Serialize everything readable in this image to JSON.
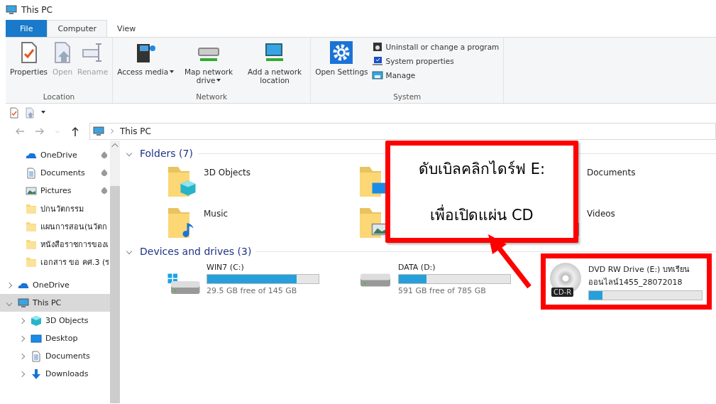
{
  "window": {
    "title": "This PC"
  },
  "tabs": [
    {
      "label": "File",
      "kind": "file",
      "selected": false
    },
    {
      "label": "Computer",
      "kind": "tab",
      "selected": true
    },
    {
      "label": "View",
      "kind": "tab",
      "selected": false
    }
  ],
  "ribbon": {
    "groups": [
      {
        "name": "Location",
        "commands": [
          {
            "label": "Properties",
            "disabled": false,
            "dropdown": false
          },
          {
            "label": "Open",
            "disabled": true,
            "dropdown": false
          },
          {
            "label": "Rename",
            "disabled": true,
            "dropdown": false
          }
        ]
      },
      {
        "name": "Network",
        "commands": [
          {
            "label": "Access media",
            "disabled": false,
            "dropdown": true
          },
          {
            "label": "Map network drive",
            "disabled": false,
            "dropdown": true
          },
          {
            "label": "Add a network location",
            "disabled": false,
            "dropdown": false
          }
        ]
      },
      {
        "name": "System",
        "commands": [
          {
            "label": "Open Settings",
            "disabled": false,
            "dropdown": false
          }
        ],
        "small_commands": [
          {
            "label": "Uninstall or change a program"
          },
          {
            "label": "System properties"
          },
          {
            "label": "Manage"
          }
        ]
      }
    ]
  },
  "address": {
    "path": "This PC"
  },
  "nav": {
    "pinned_items": [
      {
        "name": "OneDrive",
        "pinned": true
      },
      {
        "name": "Documents",
        "pinned": true
      },
      {
        "name": "Pictures",
        "pinned": true
      },
      {
        "name": "ปกนวัตกรรม"
      },
      {
        "name": "แผนการสอน(นวัตก"
      },
      {
        "name": "หนังสือราชการของเ"
      },
      {
        "name": "เอกสาร ขอ คศ.3 (ร"
      }
    ],
    "tree": [
      {
        "name": "OneDrive",
        "expanded": false,
        "selected": false
      },
      {
        "name": "This PC",
        "expanded": true,
        "selected": true,
        "children": [
          {
            "name": "3D Objects",
            "expanded": false,
            "selected": false
          },
          {
            "name": "Desktop",
            "expanded": false,
            "selected": false
          },
          {
            "name": "Documents",
            "expanded": false,
            "selected": false
          },
          {
            "name": "Downloads",
            "expanded": false,
            "selected": false
          }
        ]
      }
    ]
  },
  "sections": [
    {
      "title": "Folders (7)",
      "kind": "folders",
      "items": [
        {
          "name": "3D Objects",
          "kind": "objects"
        },
        {
          "kind": "desktop"
        },
        {
          "name": "Documents",
          "kind": "documents"
        },
        {
          "name": "Music",
          "kind": "music"
        },
        {
          "kind": "pictures"
        },
        {
          "name": "Videos",
          "kind": "videos"
        }
      ]
    },
    {
      "title": "Devices and drives (3)",
      "kind": "drives",
      "items": [
        {
          "name": "WIN7 (C:)",
          "kind": "system",
          "level": 0.8,
          "free": "29.5 GB free of 145 GB",
          "highlighted": false
        },
        {
          "name": "DATA (D:)",
          "kind": "hdd",
          "level": 0.25,
          "free": "591 GB free of 785 GB",
          "highlighted": false
        },
        {
          "name": "DVD RW Drive (E:) บทเรียนออนไลน์1455_28072018",
          "kind": "optical",
          "disc_label": "CD-R",
          "level": 0.12,
          "highlighted": true
        }
      ]
    }
  ],
  "callout": {
    "lines": [
      "ดับเบิลคลิกไดร์ฟ E:",
      "เพื่อเปิดแผ่น CD"
    ]
  }
}
